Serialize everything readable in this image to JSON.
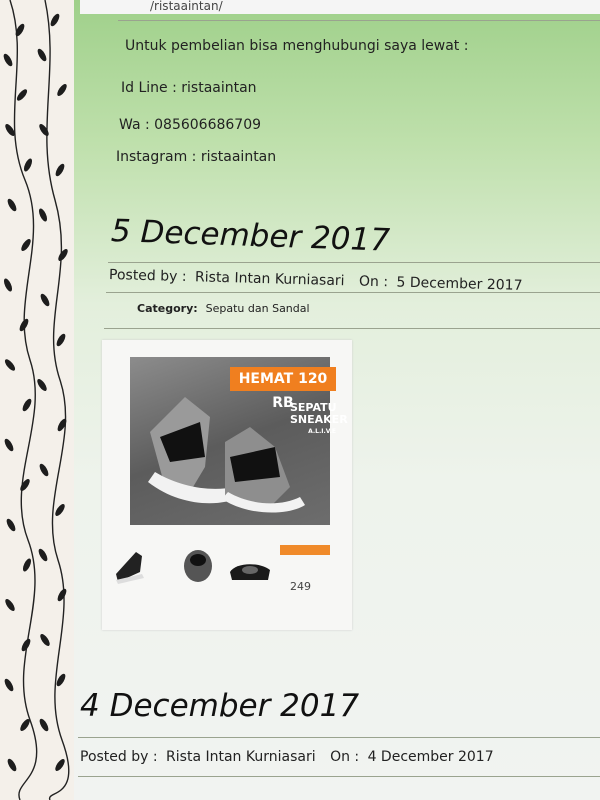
{
  "url": "/ristaaintan/",
  "contact": {
    "intro": "Untuk pembelian bisa menghubungi saya lewat :",
    "line": "Id Line : ristaaintan",
    "wa": "Wa : 085606686709",
    "instagram": "Instagram : ristaaintan"
  },
  "posts": [
    {
      "date_heading": "5 December 2017",
      "posted_by_label": "Posted by :",
      "author": "Rista Intan Kurniasari",
      "on_label": "On :",
      "date": "5 December 2017",
      "category_label": "Category:",
      "category": "Sepatu dan Sandal",
      "image": {
        "promo": "HEMAT 120 RB",
        "title_line1": "SEPATU",
        "title_line2": "SNEAKER",
        "title_line3": "A.L.I.V.E",
        "price": "249"
      }
    },
    {
      "date_heading": "4 December 2017",
      "posted_by_label": "Posted by :",
      "author": "Rista Intan Kurniasari",
      "on_label": "On :",
      "date": "4 December 2017"
    }
  ],
  "colors": {
    "page_top": "#9fd08a",
    "page_bottom": "#f1f3f1",
    "promo": "#f07f1f"
  },
  "icons": [
    "leaf-pattern"
  ]
}
